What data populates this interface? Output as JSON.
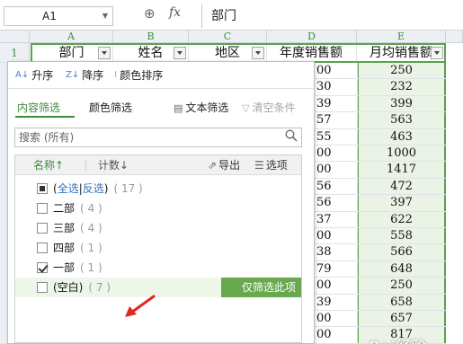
{
  "formula_bar": {
    "cell_ref": "A1",
    "fx_label": "fx",
    "content": "部门"
  },
  "columns": [
    "A",
    "B",
    "C",
    "D",
    "E"
  ],
  "row_number": "1",
  "header_cells": [
    "部门",
    "姓名",
    "地区",
    "年度销售额",
    "月均销售额"
  ],
  "visible_values": [
    {
      "d": "00",
      "e": "250"
    },
    {
      "d": "30",
      "e": "232"
    },
    {
      "d": "39",
      "e": "399"
    },
    {
      "d": "57",
      "e": "563"
    },
    {
      "d": "55",
      "e": "463"
    },
    {
      "d": "00",
      "e": "1000"
    },
    {
      "d": "00",
      "e": "1417"
    },
    {
      "d": "56",
      "e": "472"
    },
    {
      "d": "56",
      "e": "397"
    },
    {
      "d": "37",
      "e": "622"
    },
    {
      "d": "00",
      "e": "558"
    },
    {
      "d": "38",
      "e": "566"
    },
    {
      "d": "79",
      "e": "648"
    },
    {
      "d": "00",
      "e": "250"
    },
    {
      "d": "39",
      "e": "658"
    },
    {
      "d": "00",
      "e": "657"
    },
    {
      "d": "00",
      "e": "817"
    }
  ],
  "filter_panel": {
    "sort_asc": "升序",
    "sort_desc": "降序",
    "sort_color": "颜色排序",
    "tab_content": "内容筛选",
    "tab_color": "颜色筛选",
    "text_filter": "文本筛选",
    "clear_filter": "清空条件",
    "search_placeholder": "搜索 (所有)",
    "list_header": {
      "name": "名称↑",
      "count": "计数↓",
      "export": "导出",
      "options": "选项"
    },
    "select_all": {
      "prefix": "(",
      "all": "全选",
      "sep": "|",
      "invert": "反选",
      "suffix": ")",
      "count": "( 17 )"
    },
    "items": [
      {
        "label": "二部",
        "count": "( 4 )",
        "checked": false
      },
      {
        "label": "三部",
        "count": "( 4 )",
        "checked": false
      },
      {
        "label": "四部",
        "count": "( 1 )",
        "checked": false
      },
      {
        "label": "一部",
        "count": "( 1 )",
        "checked": true
      },
      {
        "label": "(空白)",
        "count": "( 7 )",
        "checked": false
      }
    ],
    "only_this": "仅筛选此项"
  },
  "watermark": "Bai经验",
  "colors": {
    "accent_green": "#3b8c3b",
    "selection_green": "#5ba24c",
    "only_btn": "#6aa84f",
    "arrow_red": "#e0281e"
  }
}
